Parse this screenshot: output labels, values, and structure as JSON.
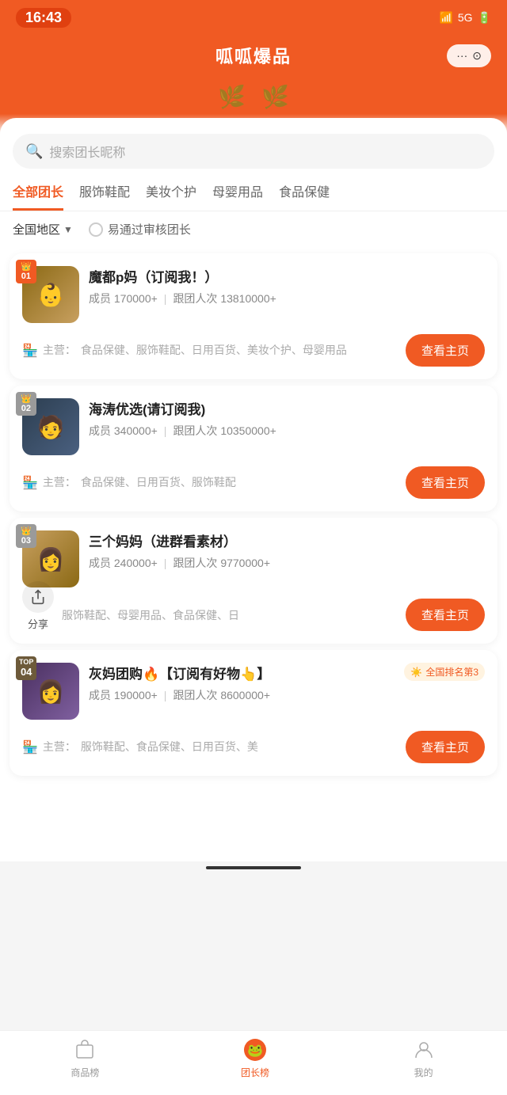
{
  "statusBar": {
    "time": "16:43",
    "signal": "5G"
  },
  "header": {
    "title": "呱呱爆品",
    "dotsLabel": "···",
    "cameraLabel": "⊙"
  },
  "search": {
    "placeholder": "搜索团长昵称"
  },
  "tabs": [
    {
      "label": "全部团长",
      "active": true
    },
    {
      "label": "服饰鞋配",
      "active": false
    },
    {
      "label": "美妆个护",
      "active": false
    },
    {
      "label": "母婴用品",
      "active": false
    },
    {
      "label": "食品保健",
      "active": false
    }
  ],
  "filters": {
    "region": "全国地区",
    "easyApproval": "易通过审核团长"
  },
  "cards": [
    {
      "rank": "01",
      "rankType": "crown",
      "name": "魔都p妈（订阅我！）",
      "members": "成员 170000+",
      "orders": "跟团人次 13810000+",
      "mainBusiness": "主营：",
      "categories": "食品保健、服饰鞋配、日用百货、美妆个护、母婴用品",
      "btnLabel": "查看主页",
      "avatarBg": "avatar-1"
    },
    {
      "rank": "02",
      "rankType": "crown",
      "name": "海涛优选(请订阅我)",
      "members": "成员 340000+",
      "orders": "跟团人次 10350000+",
      "mainBusiness": "主营：",
      "categories": "食品保健、日用百货、服饰鞋配",
      "btnLabel": "查看主页",
      "avatarBg": "avatar-2"
    },
    {
      "rank": "03",
      "rankType": "crown",
      "name": "三个妈妈（进群看素材）",
      "members": "成员 240000+",
      "orders": "跟团人次 9770000+",
      "mainBusiness": "主营：",
      "categories": "服饰鞋配、母婴用品、食品保健、日",
      "btnLabel": "查看主页",
      "avatarBg": "avatar-3",
      "hasShare": true
    },
    {
      "rank": "04",
      "rankType": "top",
      "name": "灰妈团购🔥【订阅有好物👆】",
      "members": "成员 190000+",
      "orders": "跟团人次 8600000+",
      "mainBusiness": "主营：",
      "categories": "服饰鞋配、食品保健、日用百货、美",
      "btnLabel": "查看主页",
      "avatarBg": "avatar-4",
      "nationalRank": "全国排名第3"
    }
  ],
  "bottomNav": [
    {
      "label": "商品榜",
      "active": false,
      "icon": "🛍"
    },
    {
      "label": "团长榜",
      "active": true,
      "icon": "🐸"
    },
    {
      "label": "我的",
      "active": false,
      "icon": "🐸"
    }
  ],
  "shareLabel": "分享"
}
